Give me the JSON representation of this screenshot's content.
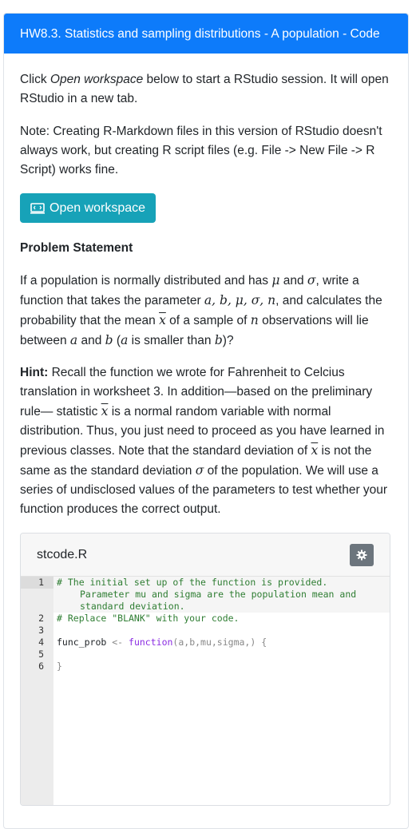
{
  "header": {
    "title": "HW8.3. Statistics and sampling distributions - A population - Code"
  },
  "intro": {
    "p1_pre": "Click ",
    "p1_em": "Open workspace",
    "p1_post": " below to start a RStudio session. It will open RStudio in a new tab.",
    "p2": "Note: Creating R-Markdown files in this version of RStudio doesn't always work, but creating R script files (e.g. File -> New File -> R Script) works fine."
  },
  "workspace_button": {
    "label": "Open workspace",
    "icon": "terminal-icon"
  },
  "problem": {
    "heading": "Problem Statement",
    "p_a": "If a population is normally distributed and has ",
    "mu": "μ",
    "p_b": " and ",
    "sigma": "σ",
    "p_c": ", write a function that takes the parameter ",
    "params": "a, b, μ, σ, n",
    "p_d": ", and calculates the probability that the mean ",
    "xbar": "x",
    "p_e": " of a sample of ",
    "n": "n",
    "p_f": " observations will lie between ",
    "a": "a",
    "p_g": " and ",
    "b": "b",
    "p_h": " (",
    "a2": "a",
    "p_i": " is smaller than ",
    "b2": "b",
    "p_j": ")?"
  },
  "hint": {
    "label": "Hint:",
    "t1": " Recall the function we wrote for Fahrenheit to Celcius translation in worksheet 3. In addition—based on the preliminary rule— statistic ",
    "xbar1": "x",
    "t2": " is a normal random variable with normal distribution. Thus, you just need to proceed as you have learned in previous classes. Note that the standard deviation of ",
    "xbar2": "x",
    "t3": " is not the same as the standard deviation ",
    "sigma": "σ",
    "t4": " of the population. We will use a series of undisclosed values of the parameters to test whether your function produces the correct output."
  },
  "code_panel": {
    "filename": "stcode.R",
    "settings_icon": "gear-icon",
    "line_numbers": [
      "1",
      "2",
      "3",
      "4",
      "5",
      "6"
    ],
    "line1": "# The initial set up of the function is provided.",
    "line1_cont": "Parameter mu and sigma are the population mean and standard deviation.",
    "line2": "# Replace \"BLANK\" with your code.",
    "line4_name": "func_prob ",
    "line4_assign": "<-",
    "line4_kw": " function",
    "line4_args": "(a,b,mu,sigma,) ",
    "line4_brace": "{",
    "line6": "}"
  }
}
